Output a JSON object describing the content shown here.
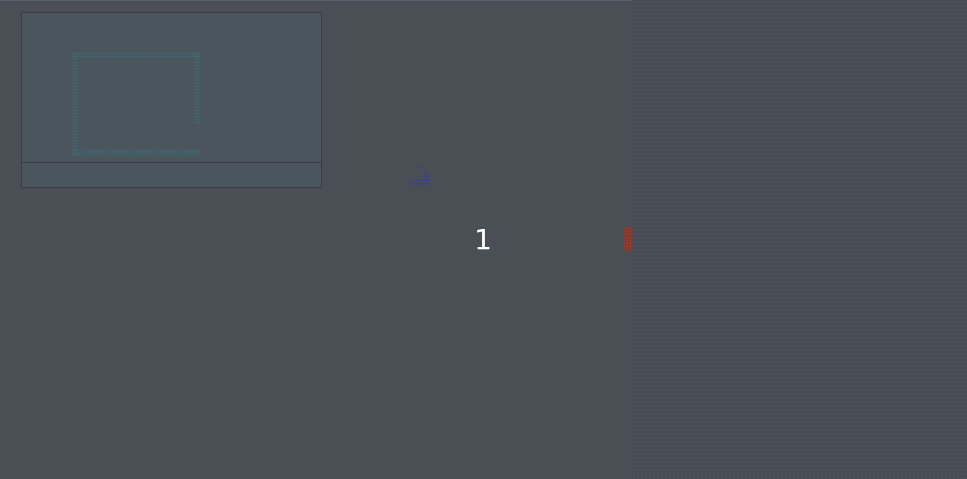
{
  "game": {
    "counter": "1"
  },
  "colors": {
    "background": "#4a4e55",
    "minimap_fill": "#4a555d",
    "minimap_wall": "#3f6a72",
    "player": "#3c3f8a",
    "enemy_block": "#a03a2c",
    "counter_text": "#ffffff"
  },
  "icons": {
    "player": "player-sprite-icon",
    "block": "red-block-icon"
  }
}
